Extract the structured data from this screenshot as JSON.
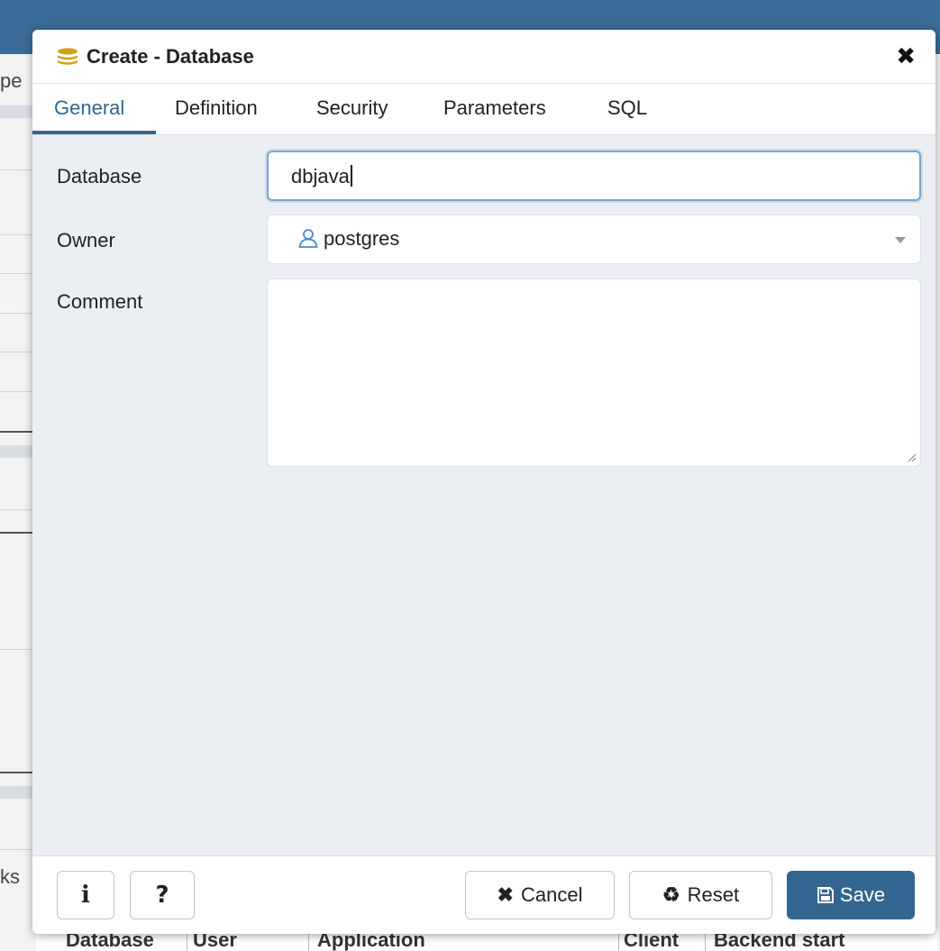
{
  "dialog": {
    "title": "Create - Database",
    "close_icon": "close-icon",
    "title_icon": "database-icon"
  },
  "tabs": [
    {
      "label": "General",
      "active": true
    },
    {
      "label": "Definition",
      "active": false
    },
    {
      "label": "Security",
      "active": false
    },
    {
      "label": "Parameters",
      "active": false
    },
    {
      "label": "SQL",
      "active": false
    }
  ],
  "form": {
    "database": {
      "label": "Database",
      "value": "dbjava"
    },
    "owner": {
      "label": "Owner",
      "value": "postgres",
      "icon": "user-icon"
    },
    "comment": {
      "label": "Comment",
      "value": ""
    }
  },
  "footer": {
    "info_label": "i",
    "help_label": "?",
    "cancel_label": "Cancel",
    "reset_label": "Reset",
    "save_label": "Save"
  },
  "background": {
    "left_fragments": [
      "pe",
      "ks"
    ],
    "table_headers": [
      "Database",
      "User",
      "Application",
      "Client",
      "Backend start"
    ]
  },
  "colors": {
    "primary": "#326690",
    "topbar": "#3b6b97",
    "dialog_body": "#ebeef3",
    "focus_border": "#7aa5ce"
  }
}
